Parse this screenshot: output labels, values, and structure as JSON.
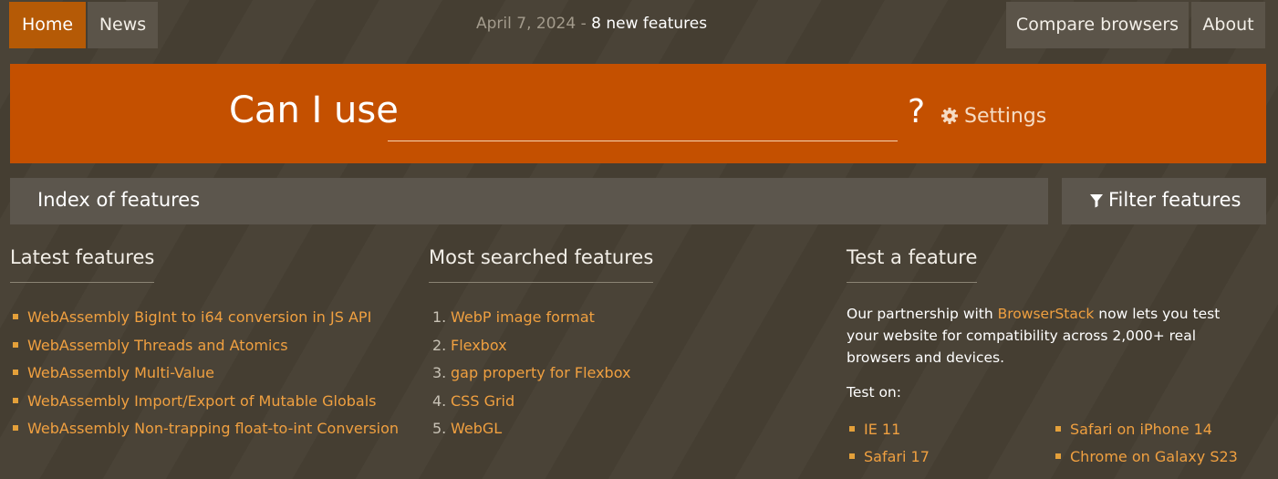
{
  "nav": {
    "home": "Home",
    "news": "News",
    "compare": "Compare browsers",
    "about": "About"
  },
  "top_info": {
    "date": "April 7, 2024",
    "separator": "-",
    "new_features": "8 new features"
  },
  "hero": {
    "title": "Can I use",
    "search_value": "",
    "question": "?",
    "settings_label": "Settings"
  },
  "index_bar": {
    "label": "Index of features"
  },
  "filter": {
    "label": "Filter features"
  },
  "latest": {
    "heading": "Latest features",
    "items": [
      "WebAssembly BigInt to i64 conversion in JS API",
      "WebAssembly Threads and Atomics",
      "WebAssembly Multi-Value",
      "WebAssembly Import/Export of Mutable Globals",
      "WebAssembly Non-trapping float-to-int Conversion"
    ]
  },
  "most_searched": {
    "heading": "Most searched features",
    "items": [
      {
        "num": "1.",
        "label": "WebP image format"
      },
      {
        "num": "2.",
        "label": "Flexbox"
      },
      {
        "num": "3.",
        "label": "gap property for Flexbox"
      },
      {
        "num": "4.",
        "label": "CSS Grid"
      },
      {
        "num": "5.",
        "label": "WebGL"
      }
    ]
  },
  "test": {
    "heading": "Test a feature",
    "text_before": "Our partnership with ",
    "link": "BrowserStack",
    "text_after": " now lets you test your website for compatibility across 2,000+ real browsers and devices.",
    "test_on": "Test on:",
    "browsers": [
      "IE 11",
      "Safari on iPhone 14",
      "Safari 17",
      "Chrome on Galaxy S23"
    ]
  },
  "colors": {
    "accent": "#c45000",
    "home_active": "#b55a06",
    "link": "#f0a040",
    "background": "#463f33"
  }
}
